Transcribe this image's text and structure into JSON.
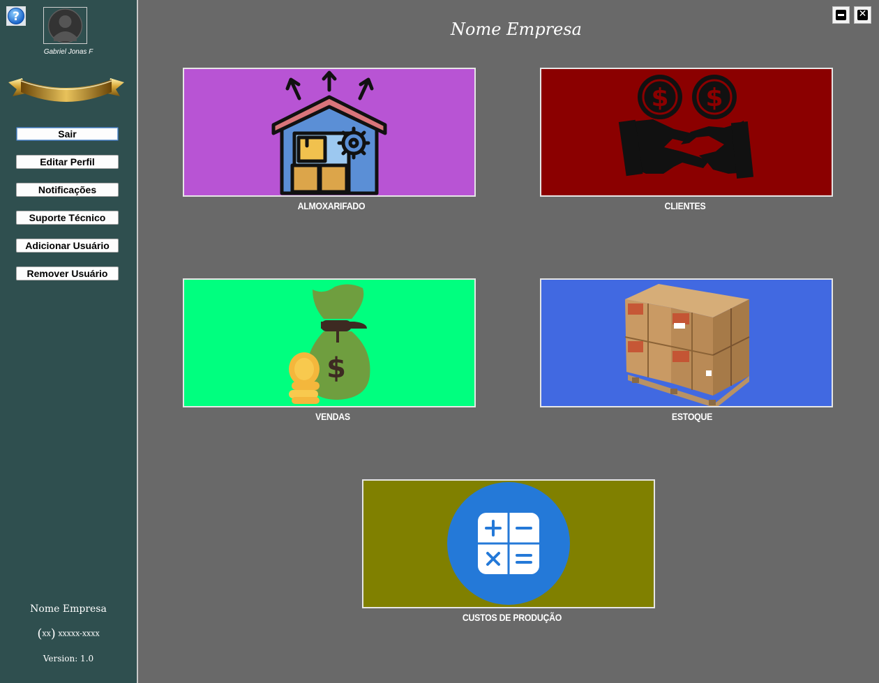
{
  "sidebar": {
    "user_name": "Gabriel Jonas F",
    "buttons": [
      "Sair",
      "Editar Perfil",
      "Notificações",
      "Suporte Técnico",
      "Adicionar Usuário",
      "Remover Usuário"
    ],
    "company": "Nome Empresa",
    "phone_area": "xx",
    "phone_number": "xxxxx-xxxx",
    "version": "Version: 1.0"
  },
  "header": {
    "title": "Nome Empresa"
  },
  "tiles": [
    {
      "label": "ALMOXARIFADO",
      "color": "#b854d4"
    },
    {
      "label": "CLIENTES",
      "color": "#8b0000"
    },
    {
      "label": "VENDAS",
      "color": "#00ff7f"
    },
    {
      "label": "ESTOQUE",
      "color": "#4169e1"
    },
    {
      "label": "CUSTOS DE PRODUÇÃO",
      "color": "#808000"
    }
  ],
  "icons": {
    "help": "help-icon",
    "avatar": "user-avatar-icon",
    "minimize": "minimize-icon",
    "close": "close-icon"
  }
}
